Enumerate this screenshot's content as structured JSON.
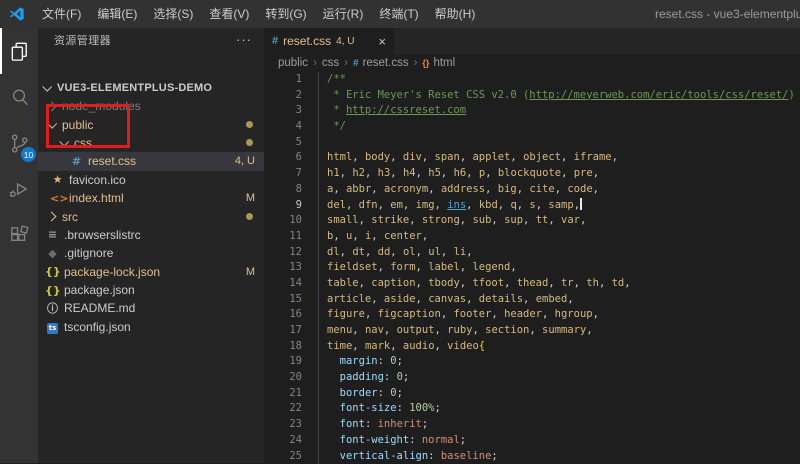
{
  "window": {
    "title": "reset.css - vue3-elementplus-demo",
    "menus": [
      "文件(F)",
      "编辑(E)",
      "选择(S)",
      "查看(V)",
      "转到(G)",
      "运行(R)",
      "终端(T)",
      "帮助(H)"
    ]
  },
  "activity_bar": {
    "items": [
      {
        "name": "explorer",
        "active": true
      },
      {
        "name": "search",
        "active": false
      },
      {
        "name": "source-control",
        "active": false,
        "badge": "10"
      },
      {
        "name": "run-debug",
        "active": false
      },
      {
        "name": "extensions",
        "active": false
      }
    ]
  },
  "sidebar": {
    "header": "资源管理器",
    "more": "···",
    "tree": [
      {
        "label": "VUE3-ELEMENTPLUS-DEMO",
        "level": 0,
        "chevron": "down",
        "root": true
      },
      {
        "label": "node_modules",
        "level": 1,
        "chevron": "right",
        "dim": true
      },
      {
        "label": "public",
        "level": 1,
        "chevron": "down",
        "gold": true,
        "badge": "dot"
      },
      {
        "label": "css",
        "level": 2,
        "chevron": "down",
        "gold": true,
        "badge": "dot"
      },
      {
        "label": "reset.css",
        "level": 3,
        "icon": "css",
        "gold": true,
        "badge": "4, U",
        "selected": true
      },
      {
        "label": "favicon.ico",
        "level": 2,
        "icon": "star"
      },
      {
        "label": "index.html",
        "level": 2,
        "icon": "html",
        "gold": true,
        "badge": "M"
      },
      {
        "label": "src",
        "level": 1,
        "chevron": "right",
        "gold": true,
        "badge": "dot"
      },
      {
        "label": ".browserslistrc",
        "level": 1,
        "icon": "list"
      },
      {
        "label": ".gitignore",
        "level": 1,
        "icon": "diamond"
      },
      {
        "label": "package-lock.json",
        "level": 1,
        "icon": "json",
        "gold": true,
        "badge": "M"
      },
      {
        "label": "package.json",
        "level": 1,
        "icon": "json"
      },
      {
        "label": "README.md",
        "level": 1,
        "icon": "info"
      },
      {
        "label": "tsconfig.json",
        "level": 1,
        "icon": "ts"
      }
    ]
  },
  "editor": {
    "tab": {
      "icon": "#",
      "label": "reset.css",
      "decoration": "4, U",
      "close": "×"
    },
    "breadcrumbs": [
      {
        "label": "public"
      },
      {
        "label": "css"
      },
      {
        "label": "reset.css",
        "icon": "css"
      },
      {
        "label": "html",
        "icon": "symbol"
      }
    ],
    "code_lines": [
      {
        "num": 1,
        "tokens": [
          [
            "c",
            "/**"
          ]
        ]
      },
      {
        "num": 2,
        "tokens": [
          [
            "c",
            " * Eric Meyer's Reset CSS v2.0 ("
          ],
          [
            "cl",
            "http://meyerweb.com/eric/tools/css/reset/"
          ],
          [
            "c",
            ")"
          ]
        ]
      },
      {
        "num": 3,
        "tokens": [
          [
            "c",
            " * "
          ],
          [
            "cl",
            "http://cssreset.com"
          ]
        ]
      },
      {
        "num": 4,
        "tokens": [
          [
            "c",
            " */"
          ]
        ]
      },
      {
        "num": 5,
        "tokens": []
      },
      {
        "num": 6,
        "sel": [
          "html",
          "body",
          "div",
          "span",
          "applet",
          "object",
          "iframe"
        ]
      },
      {
        "num": 7,
        "sel": [
          "h1",
          "h2",
          "h3",
          "h4",
          "h5",
          "h6",
          "p",
          "blockquote",
          "pre"
        ]
      },
      {
        "num": 8,
        "sel": [
          "a",
          "abbr",
          "acronym",
          "address",
          "big",
          "cite",
          "code"
        ]
      },
      {
        "num": 9,
        "sel": [
          "del",
          "dfn",
          "em",
          "img",
          "ins",
          "kbd",
          "q",
          "s",
          "samp"
        ],
        "link_word": "ins",
        "cursor": true,
        "active": true
      },
      {
        "num": 10,
        "sel": [
          "small",
          "strike",
          "strong",
          "sub",
          "sup",
          "tt",
          "var"
        ]
      },
      {
        "num": 11,
        "sel": [
          "b",
          "u",
          "i",
          "center"
        ]
      },
      {
        "num": 12,
        "sel": [
          "dl",
          "dt",
          "dd",
          "ol",
          "ul",
          "li"
        ]
      },
      {
        "num": 13,
        "sel": [
          "fieldset",
          "form",
          "label",
          "legend"
        ]
      },
      {
        "num": 14,
        "sel": [
          "table",
          "caption",
          "tbody",
          "tfoot",
          "thead",
          "tr",
          "th",
          "td"
        ]
      },
      {
        "num": 15,
        "sel": [
          "article",
          "aside",
          "canvas",
          "details",
          "embed"
        ]
      },
      {
        "num": 16,
        "sel": [
          "figure",
          "figcaption",
          "footer",
          "header",
          "hgroup"
        ]
      },
      {
        "num": 17,
        "sel": [
          "menu",
          "nav",
          "output",
          "ruby",
          "section",
          "summary"
        ]
      },
      {
        "num": 18,
        "sel": [
          "time",
          "mark",
          "audio",
          "video"
        ],
        "brace": true
      },
      {
        "num": 19,
        "tokens": [
          [
            "w",
            "  "
          ],
          [
            "pr",
            "margin"
          ],
          [
            "o",
            ": "
          ],
          [
            "n",
            "0"
          ],
          [
            "o",
            ";"
          ]
        ]
      },
      {
        "num": 20,
        "tokens": [
          [
            "w",
            "  "
          ],
          [
            "pr",
            "padding"
          ],
          [
            "o",
            ": "
          ],
          [
            "n",
            "0"
          ],
          [
            "o",
            ";"
          ]
        ]
      },
      {
        "num": 21,
        "tokens": [
          [
            "w",
            "  "
          ],
          [
            "pr",
            "border"
          ],
          [
            "o",
            ": "
          ],
          [
            "n",
            "0"
          ],
          [
            "o",
            ";"
          ]
        ]
      },
      {
        "num": 22,
        "tokens": [
          [
            "w",
            "  "
          ],
          [
            "pr",
            "font-size"
          ],
          [
            "o",
            ": "
          ],
          [
            "n",
            "100%"
          ],
          [
            "o",
            ";"
          ]
        ]
      },
      {
        "num": 23,
        "tokens": [
          [
            "w",
            "  "
          ],
          [
            "pr",
            "font"
          ],
          [
            "o",
            ": "
          ],
          [
            "v",
            "inherit"
          ],
          [
            "o",
            ";"
          ]
        ]
      },
      {
        "num": 24,
        "tokens": [
          [
            "w",
            "  "
          ],
          [
            "pr",
            "font-weight"
          ],
          [
            "o",
            ": "
          ],
          [
            "v",
            "normal"
          ],
          [
            "o",
            ";"
          ]
        ]
      },
      {
        "num": 25,
        "tokens": [
          [
            "w",
            "  "
          ],
          [
            "pr",
            "vertical-align"
          ],
          [
            "o",
            ": "
          ],
          [
            "v",
            "baseline"
          ],
          [
            "o",
            ";"
          ]
        ]
      }
    ]
  },
  "annotation": {
    "shape": "red-box",
    "around": "css / reset.css tree items"
  },
  "colors": {
    "git_modified_gold": "#e2c08d",
    "badge_blue": "#0e7ad3",
    "annotation_red": "#e11c1c",
    "syntax": {
      "comment": "#6a9955",
      "tag": "#d7ba7d",
      "property": "#9cdcfe",
      "number": "#b5cea8",
      "value": "#ce9178",
      "link": "#4fa3d9"
    }
  }
}
